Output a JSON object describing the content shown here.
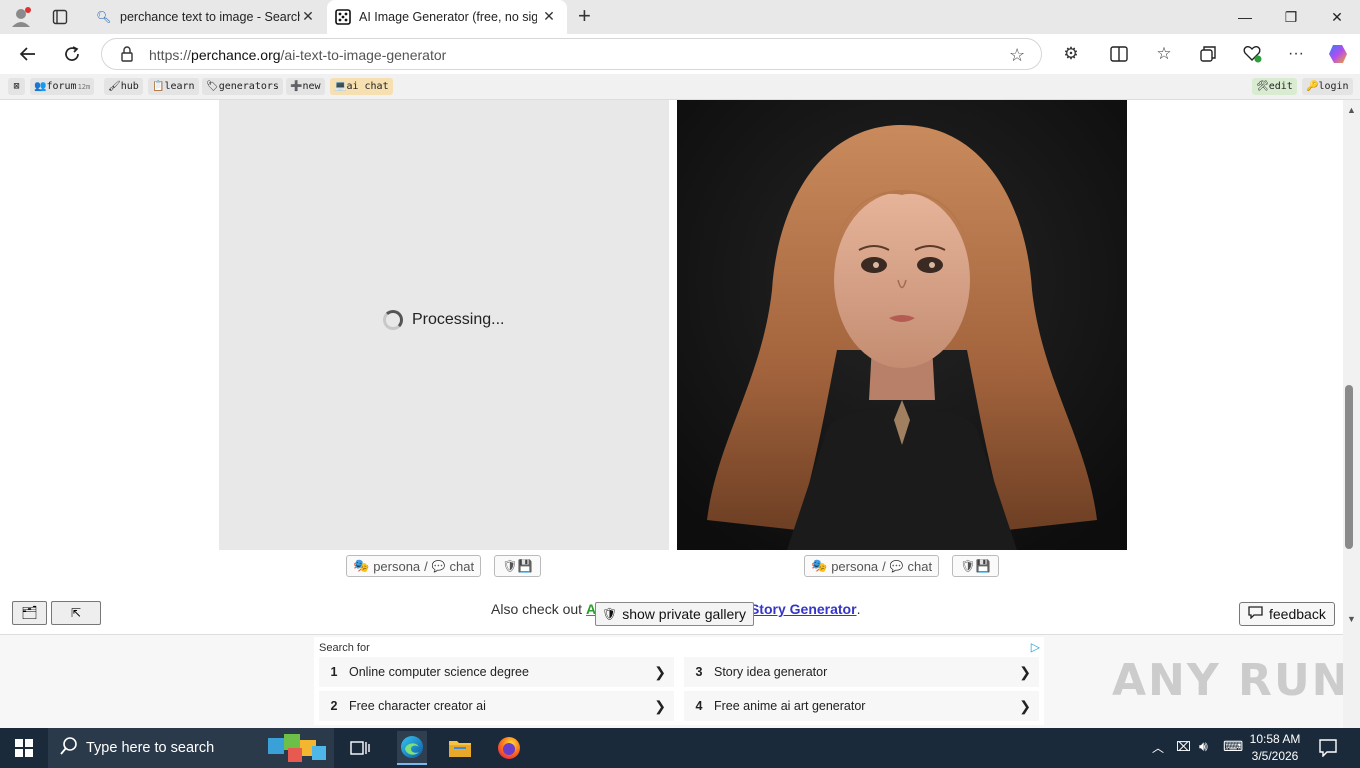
{
  "browser": {
    "tabs": [
      {
        "title": "perchance text to image - Search",
        "icon": "search-icon"
      },
      {
        "title": "AI Image Generator (free, no sign",
        "icon": "dice-icon"
      }
    ],
    "url_prefix": "https://",
    "url_host": "perchance.org",
    "url_path": "/ai-text-to-image-generator"
  },
  "perchance_toolbar": {
    "items": [
      {
        "label": "forum",
        "badge": "12m"
      },
      {
        "label": "hub"
      },
      {
        "label": "learn"
      },
      {
        "label": "generators"
      },
      {
        "label": "new"
      },
      {
        "label": "ai chat"
      }
    ],
    "right_items": [
      {
        "label": "edit"
      },
      {
        "label": "login"
      }
    ]
  },
  "page": {
    "processing_text": "Processing...",
    "persona_label": "persona",
    "chat_label": "chat",
    "also_check_prefix": "Also check out",
    "also_check_link1": "A",
    "also_check_link2": "Story Generator",
    "also_check_suffix": ".",
    "private_gallery_label": "show private gallery",
    "feedback_label": "feedback",
    "scroll_top_label": "⇱"
  },
  "ads": {
    "search_for": "Search for",
    "items": [
      {
        "num": "1",
        "label": "Online computer science degree"
      },
      {
        "num": "3",
        "label": "Story idea generator"
      },
      {
        "num": "2",
        "label": "Free character creator ai"
      },
      {
        "num": "4",
        "label": "Free anime ai art generator"
      }
    ]
  },
  "taskbar": {
    "search_placeholder": "Type here to search",
    "time": "10:58 AM",
    "date": "3/5/2026"
  },
  "watermark": "ANY RUN"
}
